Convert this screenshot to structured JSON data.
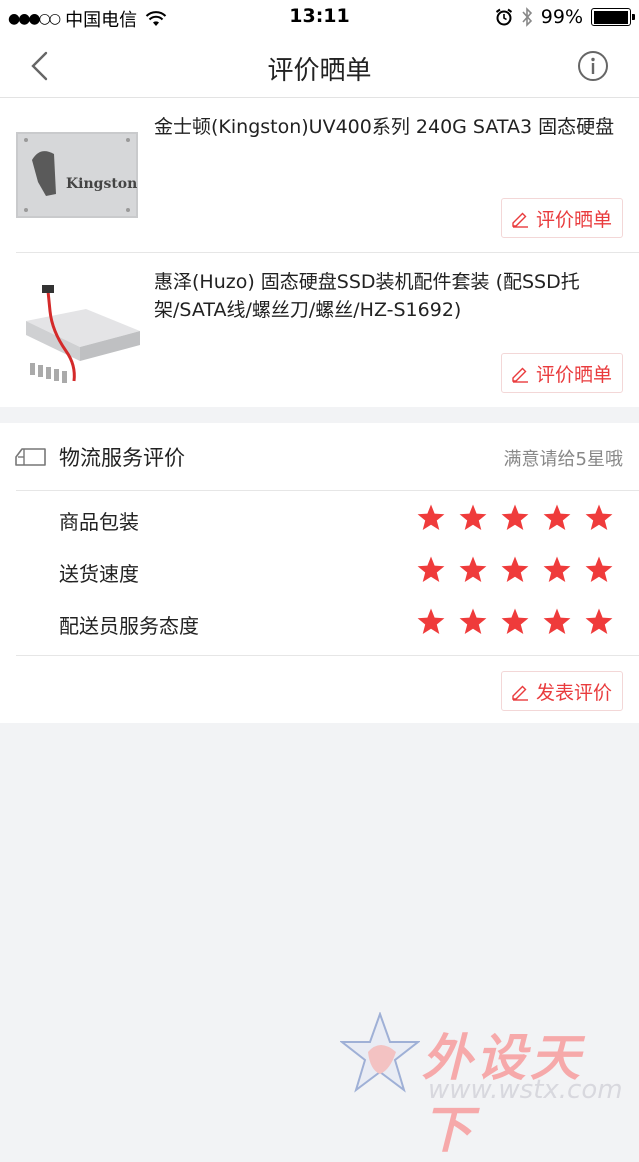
{
  "status_bar": {
    "signal": "●●●○○",
    "carrier": "中国电信",
    "time": "13:11",
    "battery": "99%",
    "battery_level": 0.99
  },
  "nav": {
    "title": "评价晒单"
  },
  "products": [
    {
      "name": "金士顿(Kingston)UV400系列 240G SATA3 固态硬盘",
      "review_label": "评价晒单",
      "brand_text": "Kingston"
    },
    {
      "name": "惠泽(Huzo) 固态硬盘SSD装机配件套装 (配SSD托架/SATA线/螺丝刀/螺丝/HZ-S1692)",
      "review_label": "评价晒单"
    }
  ],
  "logistics": {
    "title": "物流服务评价",
    "hint": "满意请给5星哦",
    "ratings": [
      {
        "label": "商品包装",
        "stars": 5,
        "max": 5
      },
      {
        "label": "送货速度",
        "stars": 5,
        "max": 5
      },
      {
        "label": "配送员服务态度",
        "stars": 5,
        "max": 5
      }
    ],
    "submit_label": "发表评价"
  },
  "watermark": {
    "text": "外设天下",
    "url": "www.wstx.com"
  },
  "colors": {
    "accent": "#e93b3d",
    "star": "#ef3b3b",
    "background": "#f2f3f5"
  }
}
